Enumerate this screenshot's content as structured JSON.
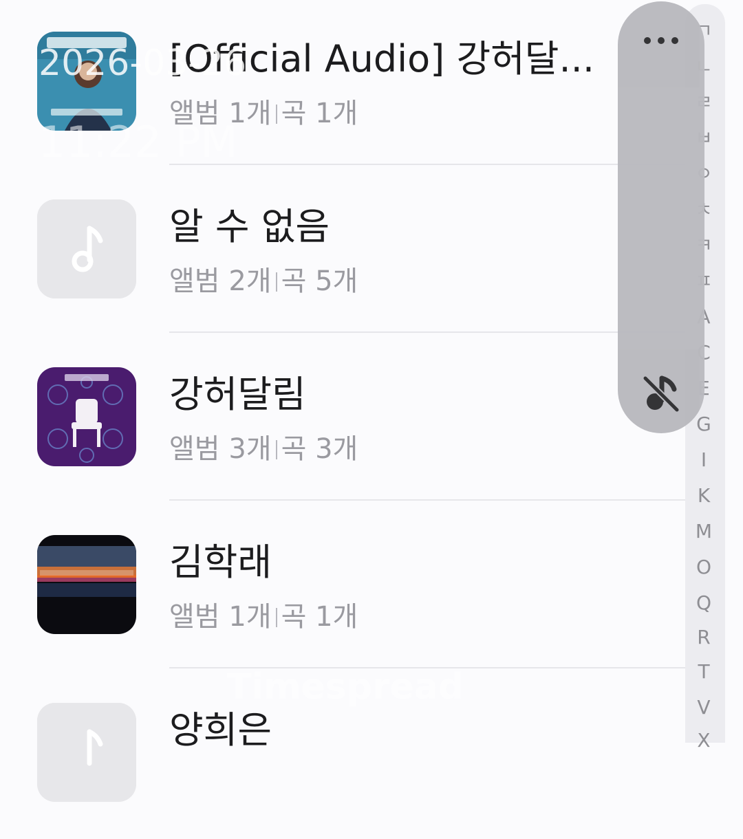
{
  "artists": [
    {
      "title": "[Official Audio] 강허달...",
      "albums": "앨범 1개",
      "songs": "곡 1개",
      "artwork": "cover-art-blue"
    },
    {
      "title": "알 수 없음",
      "albums": "앨범 2개",
      "songs": "곡 5개",
      "artwork": "music-note-placeholder"
    },
    {
      "title": "강허달림",
      "albums": "앨범 3개",
      "songs": "곡 3개",
      "artwork": "cover-art-purple-chair"
    },
    {
      "title": "김학래",
      "albums": "앨범 1개",
      "songs": "곡 1개",
      "artwork": "cover-art-sunset"
    },
    {
      "title": "양희은",
      "albums": "",
      "songs": "",
      "artwork": "music-note-placeholder"
    }
  ],
  "index_letters": [
    "ㄱ",
    "ㄴ",
    "ㄹ",
    "ㅂ",
    "ㅇ",
    "ㅊ",
    "ㅋ",
    "ㅍ",
    "A",
    "C",
    "E",
    "G",
    "I",
    "K",
    "M",
    "O",
    "Q",
    "R",
    "T",
    "V",
    "X"
  ],
  "floating_controls": {
    "more_icon": "more-horizontal-icon",
    "mute_icon": "music-off-icon"
  },
  "overlay": {
    "date": "2026-03-26",
    "time": "11:22 PM"
  },
  "watermark": "Timespread",
  "colors": {
    "cover_blue": "#3b8fb0",
    "cover_purple": "#4a1c6e",
    "cover_sunset": "#e06a2a"
  }
}
